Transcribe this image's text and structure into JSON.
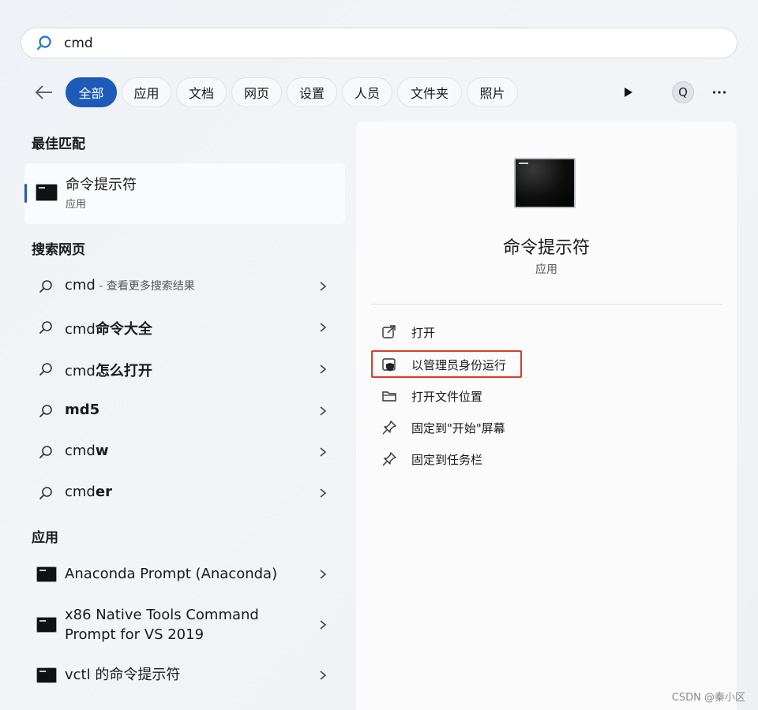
{
  "search": {
    "value": "cmd"
  },
  "filters": {
    "chips": [
      {
        "label": "全部",
        "active": true
      },
      {
        "label": "应用"
      },
      {
        "label": "文档"
      },
      {
        "label": "网页"
      },
      {
        "label": "设置"
      },
      {
        "label": "人员"
      },
      {
        "label": "文件夹"
      },
      {
        "label": "照片"
      }
    ],
    "avatar_letter": "Q"
  },
  "best_match": {
    "header": "最佳匹配",
    "title": "命令提示符",
    "subtitle": "应用"
  },
  "web_search": {
    "header": "搜索网页",
    "items": [
      {
        "prefix": "cmd",
        "bold": "",
        "hint": " - 查看更多搜索结果"
      },
      {
        "prefix": "cmd",
        "bold": "命令大全",
        "hint": ""
      },
      {
        "prefix": "cmd",
        "bold": "怎么打开",
        "hint": ""
      },
      {
        "prefix": "",
        "bold": "md5",
        "hint": ""
      },
      {
        "prefix": "cmd",
        "bold": "w",
        "hint": ""
      },
      {
        "prefix": "cmd",
        "bold": "er",
        "hint": ""
      }
    ]
  },
  "apps": {
    "header": "应用",
    "items": [
      {
        "line1": "Anaconda Prompt (Anaconda)",
        "line2": ""
      },
      {
        "line1": "x86 Native Tools Command",
        "line2": "Prompt for VS 2019"
      },
      {
        "line1": "vctl 的命令提示符",
        "line2": ""
      }
    ]
  },
  "detail": {
    "title": "命令提示符",
    "subtitle": "应用",
    "actions": [
      {
        "label": "打开",
        "icon": "open-external-icon"
      },
      {
        "label": "以管理员身份运行",
        "icon": "shield-icon"
      },
      {
        "label": "打开文件位置",
        "icon": "folder-icon"
      },
      {
        "label": "固定到\"开始\"屏幕",
        "icon": "pin-icon"
      },
      {
        "label": "固定到任务栏",
        "icon": "pin-icon"
      }
    ]
  },
  "watermark": "CSDN @秦小区",
  "colors": {
    "accent": "#1e5bb8",
    "highlight": "#e03a2a"
  }
}
